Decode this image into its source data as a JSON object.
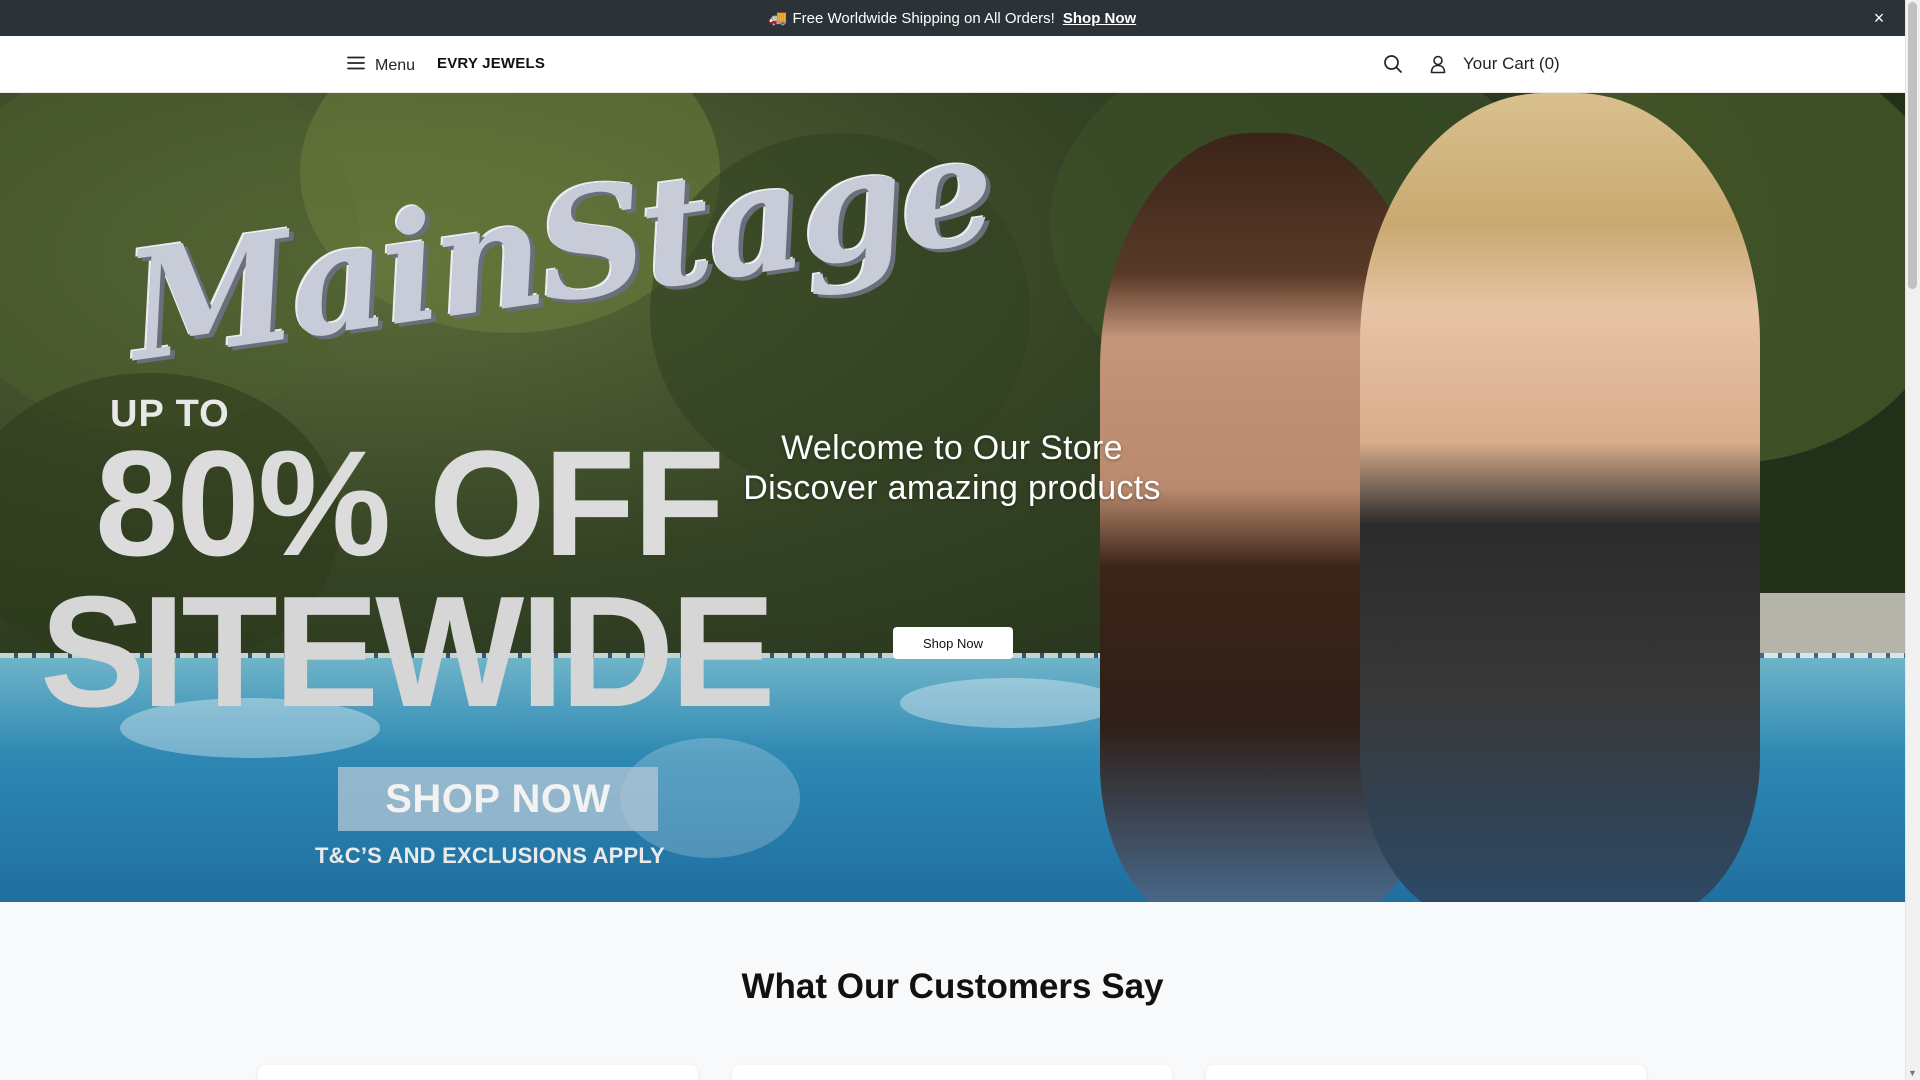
{
  "announcement": {
    "emoji": "🚚",
    "text": "Free Worldwide Shipping on All Orders!",
    "link": "Shop Now",
    "close": "×"
  },
  "header": {
    "menu_label": "Menu",
    "brand": "EVRY JEWELS",
    "cart_label": "Your Cart (0)",
    "icons": [
      "hamburger-icon",
      "search-icon",
      "user-icon"
    ]
  },
  "hero": {
    "promo": {
      "script_title": "MainStage",
      "upto": "UP TO",
      "discount": "80% OFF",
      "scope": "SITEWIDE",
      "cta": "SHOP NOW",
      "terms": "T&C’S AND EXCLUSIONS APPLY"
    },
    "headline_1": "Welcome to Our Store",
    "headline_2": "Discover amazing products",
    "cta_label": "Shop Now"
  },
  "testimonials": {
    "title": "What Our Customers Say"
  },
  "colors": {
    "announcement_bg": "#2c3338",
    "header_bg": "#ffffff",
    "page_bg": "#f8f9fb"
  }
}
